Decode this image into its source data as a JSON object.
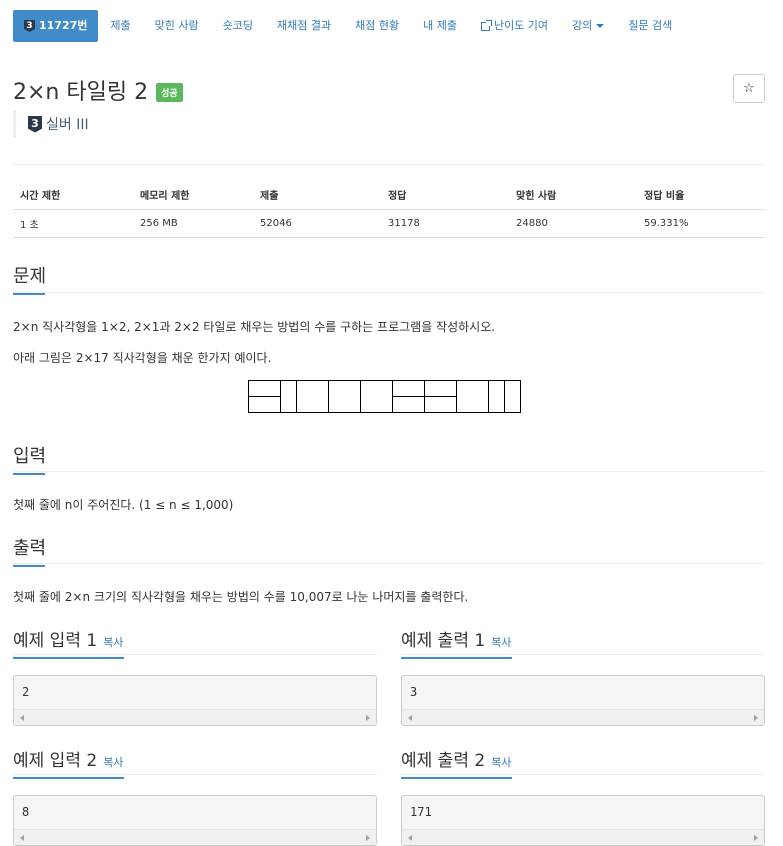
{
  "nav": {
    "problem_number": "11727번",
    "tier_digit": "3",
    "tabs": [
      "제출",
      "맞힌 사람",
      "숏코딩",
      "재채점 결과",
      "채점 현황",
      "내 제출",
      "난이도 기여",
      "강의",
      "질문 검색"
    ]
  },
  "problem": {
    "title": "2×n 타일링 2",
    "result_badge": "성공",
    "star": "☆",
    "tier_digit": "3",
    "tier_label": "실버 III"
  },
  "info_table": {
    "headers": [
      "시간 제한",
      "메모리 제한",
      "제출",
      "정답",
      "맞힌 사람",
      "정답 비율"
    ],
    "values": [
      "1 초",
      "256 MB",
      "52046",
      "31178",
      "24880",
      "59.331%"
    ]
  },
  "sections": {
    "problem_heading": "문제",
    "problem_text_1": "2×n 직사각형을 1×2, 2×1과 2×2 타일로 채우는 방법의 수를 구하는 프로그램을 작성하시오.",
    "problem_text_2": "아래 그림은 2×17 직사각형을 채운 한가지 예이다.",
    "input_heading": "입력",
    "input_text": "첫째 줄에 n이 주어진다. (1 ≤ n ≤ 1,000)",
    "output_heading": "출력",
    "output_text": "첫째 줄에 2×n 크기의 직사각형을 채우는 방법의 수를 10,007로 나눈 나머지를 출력한다."
  },
  "samples": {
    "copy_label": "복사",
    "in1_title": "예제 입력 1",
    "out1_title": "예제 출력 1",
    "in2_title": "예제 입력 2",
    "out2_title": "예제 출력 2",
    "in1": "2",
    "out1": "3",
    "in2": "8",
    "out2": "171"
  },
  "colors": {
    "accent": "#428bca",
    "link": "#337ab7",
    "success": "#5cb85c",
    "tier_silver": "#435f7a"
  }
}
